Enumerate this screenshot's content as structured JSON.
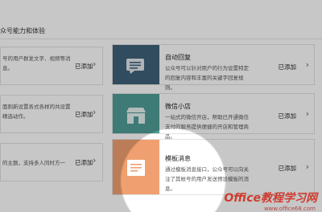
{
  "section": {
    "title": "众号能力和体验"
  },
  "left_cards": [
    {
      "desc": "号的用户群发文字、视频等消息。",
      "action": "已添加"
    },
    {
      "desc": "面则新设置各式各样的共设置精选动作。",
      "action": "已添加"
    },
    {
      "desc": "的主题，支持多人同时方一",
      "action": "已添加"
    }
  ],
  "right_cards": [
    {
      "name": "自动回复",
      "desc": "公众号可以针对用户的行为设置特定的回复内容和丰富的关键字回复规则。",
      "action": "已添加",
      "color": "#3f6278",
      "icon": "chat-bubble-icon"
    },
    {
      "name": "微信小店",
      "desc": "一站式的微信开店，帮助已开通微信支付的服务提供便捷的开店和管理商品。",
      "action": "已添加",
      "color": "#4f9e97",
      "icon": "shop-icon"
    },
    {
      "name": "模板消息",
      "desc": "通过模板消息接口，公众号可以向关注了其帐号的用户发送预设模板的消息。",
      "action": "已添加",
      "color": "#f0a070",
      "icon": "document-icon"
    }
  ],
  "watermark": {
    "brand": "Office教程学习网",
    "url": "www.office68.com"
  },
  "colors": {
    "spotlight_dim": "rgba(0,0,0,0.22)",
    "accent_blue": "#3f6278",
    "accent_teal": "#4f9e97",
    "accent_orange": "#f0a070"
  }
}
